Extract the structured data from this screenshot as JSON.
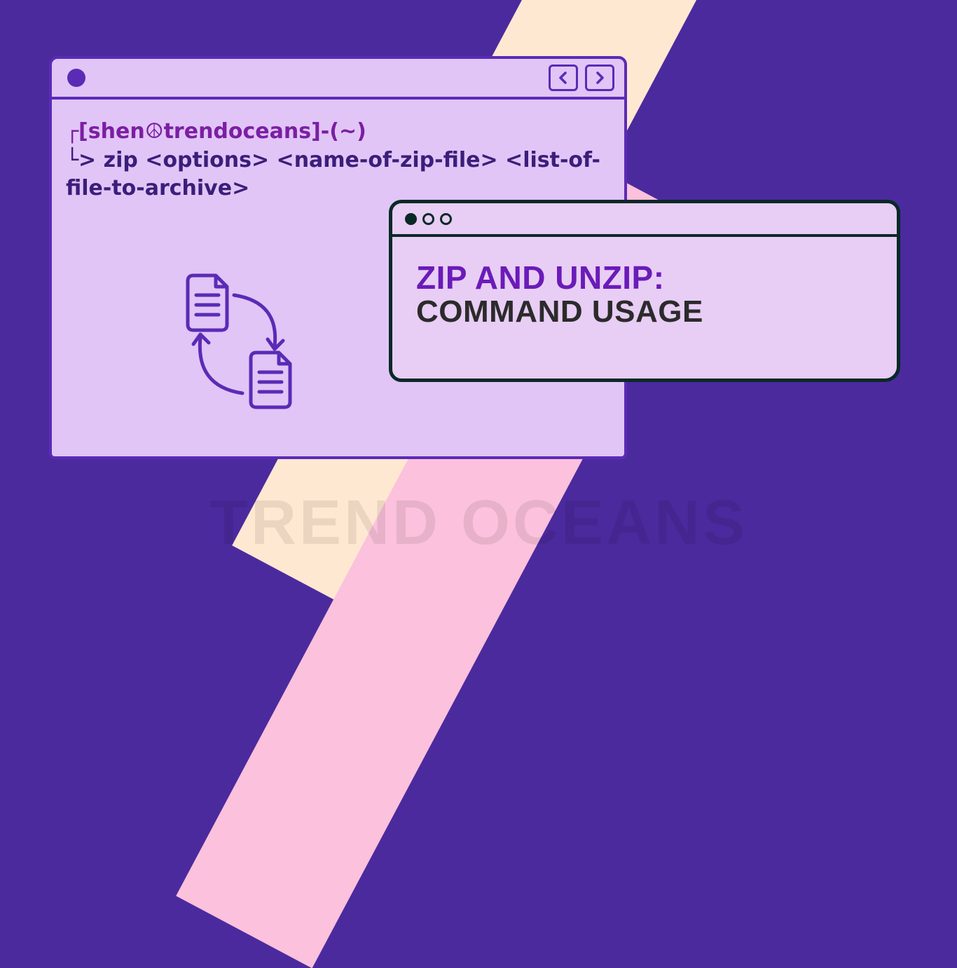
{
  "terminal": {
    "prompt_user": "┌[shen☮trendoceans]-(~)",
    "prompt_cmd": "└> zip <options> <name-of-zip-file> <list-of-file-to-archive>"
  },
  "card": {
    "title_line1": "ZIP AND UNZIP:",
    "title_line2": "COMMAND USAGE"
  },
  "watermark": "TREND OCEANS",
  "colors": {
    "bg": "#4b2a9e",
    "stripe_cream": "#ffe8d1",
    "stripe_pink": "#fcc1dc",
    "panel": "#e1c5f7",
    "panel_border": "#5b2bb5",
    "card_border": "#0a2926",
    "heading_purple": "#6a1bb8"
  }
}
